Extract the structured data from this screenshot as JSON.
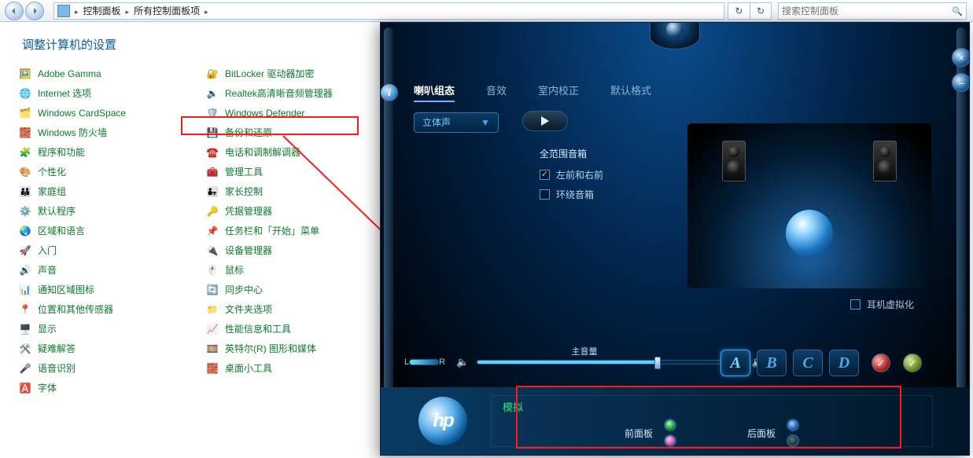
{
  "nav": {
    "crumb1": "控制面板",
    "crumb2": "所有控制面板项",
    "search_placeholder": "搜索控制面板"
  },
  "cp": {
    "heading": "调整计算机的设置",
    "col1": [
      {
        "icon": "🖼️",
        "label": "Adobe Gamma"
      },
      {
        "icon": "🌐",
        "label": "Internet 选项"
      },
      {
        "icon": "🗂️",
        "label": "Windows CardSpace"
      },
      {
        "icon": "🧱",
        "label": "Windows 防火墙"
      },
      {
        "icon": "🧩",
        "label": "程序和功能"
      },
      {
        "icon": "🎨",
        "label": "个性化"
      },
      {
        "icon": "👪",
        "label": "家庭组"
      },
      {
        "icon": "⚙️",
        "label": "默认程序"
      },
      {
        "icon": "🌏",
        "label": "区域和语言"
      },
      {
        "icon": "🚀",
        "label": "入门"
      },
      {
        "icon": "🔊",
        "label": "声音"
      },
      {
        "icon": "📊",
        "label": "通知区域图标"
      },
      {
        "icon": "📍",
        "label": "位置和其他传感器"
      },
      {
        "icon": "🖥️",
        "label": "显示"
      },
      {
        "icon": "🛠️",
        "label": "疑难解答"
      },
      {
        "icon": "🎤",
        "label": "语音识别"
      },
      {
        "icon": "🅰️",
        "label": "字体"
      }
    ],
    "col2": [
      {
        "icon": "🔐",
        "label": "BitLocker 驱动器加密"
      },
      {
        "icon": "🔉",
        "label": "Realtek高清晰音频管理器"
      },
      {
        "icon": "🛡️",
        "label": "Windows Defender"
      },
      {
        "icon": "💾",
        "label": "备份和还原"
      },
      {
        "icon": "☎️",
        "label": "电话和调制解调器"
      },
      {
        "icon": "🧰",
        "label": "管理工具"
      },
      {
        "icon": "👨‍👧",
        "label": "家长控制"
      },
      {
        "icon": "🔑",
        "label": "凭据管理器"
      },
      {
        "icon": "📌",
        "label": "任务栏和「开始」菜单"
      },
      {
        "icon": "🔌",
        "label": "设备管理器"
      },
      {
        "icon": "🖱️",
        "label": "鼠标"
      },
      {
        "icon": "🔄",
        "label": "同步中心"
      },
      {
        "icon": "📁",
        "label": "文件夹选项"
      },
      {
        "icon": "📈",
        "label": "性能信息和工具"
      },
      {
        "icon": "🎞️",
        "label": "英特尔(R) 图形和媒体"
      },
      {
        "icon": "🧱",
        "label": "桌面小工具"
      }
    ]
  },
  "audio": {
    "tabs": {
      "t1": "喇叭组态",
      "t2": "音效",
      "t3": "室内校正",
      "t4": "默认格式"
    },
    "select_label": "立体声",
    "range_title": "全范围音箱",
    "chk_front": "左前和右前",
    "chk_surround": "环绕音箱",
    "hp_virtual": "耳机虚拟化",
    "main_volume_label": "主音量",
    "balance_l": "L",
    "balance_r": "R",
    "devA": "A",
    "devB": "B",
    "devC": "C",
    "devD": "D",
    "panel_title": "模拟",
    "front_panel": "前面板",
    "rear_panel": "后面板",
    "info_char": "i",
    "close_char": "×",
    "min_char": "–",
    "logo_text": "hp"
  }
}
